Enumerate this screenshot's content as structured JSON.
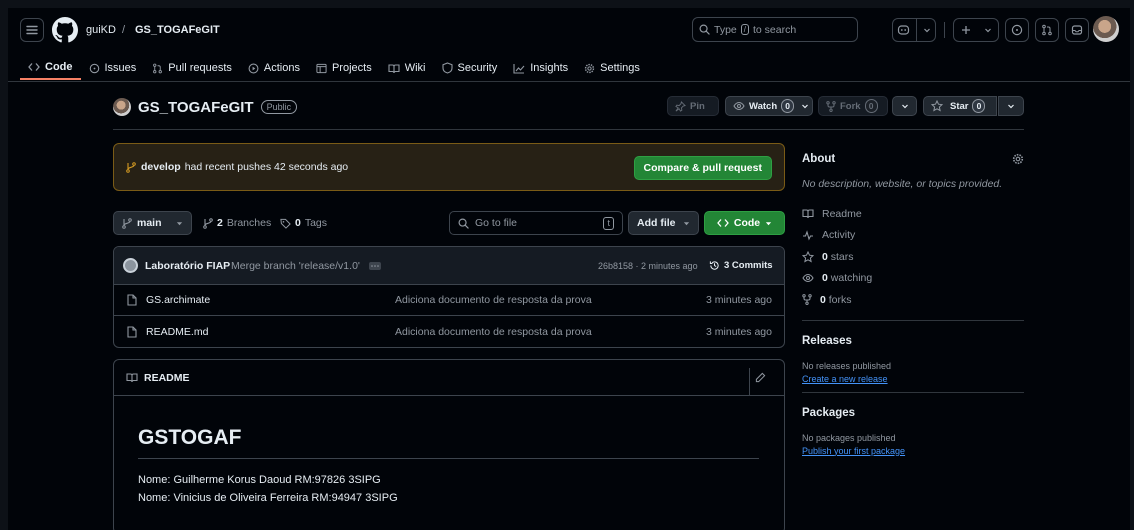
{
  "header": {
    "owner": "guiKD",
    "separator": "/",
    "repo": "GS_TOGAFeGIT",
    "search_placeholder": "Type / to search",
    "search_key": "/",
    "search_prefix": "Type",
    "search_suffix": "to search"
  },
  "tabs": [
    {
      "label": "Code",
      "icon": "code-icon",
      "active": true
    },
    {
      "label": "Issues",
      "icon": "issue-icon"
    },
    {
      "label": "Pull requests",
      "icon": "pull-request-icon"
    },
    {
      "label": "Actions",
      "icon": "play-icon"
    },
    {
      "label": "Projects",
      "icon": "table-icon"
    },
    {
      "label": "Wiki",
      "icon": "book-icon"
    },
    {
      "label": "Security",
      "icon": "shield-icon"
    },
    {
      "label": "Insights",
      "icon": "graph-icon"
    },
    {
      "label": "Settings",
      "icon": "gear-icon"
    }
  ],
  "repo_header": {
    "name": "GS_TOGAFeGIT",
    "visibility": "Public",
    "pin": "Pin",
    "watch": "Watch",
    "watch_count": "0",
    "fork": "Fork",
    "fork_count": "0",
    "star": "Star",
    "star_count": "0"
  },
  "push_banner": {
    "branch": "develop",
    "text": "had recent pushes 42 seconds ago",
    "button": "Compare & pull request"
  },
  "file_nav": {
    "branch": "main",
    "branches_count": "2",
    "branches_label": "Branches",
    "tags_count": "0",
    "tags_label": "Tags",
    "go_to_file": "Go to file",
    "go_to_file_key": "t",
    "add_file": "Add file",
    "code": "Code"
  },
  "latest_commit": {
    "author": "Laboratório FIAP",
    "message": "Merge branch 'release/v1.0'",
    "hash_time": "26b8158 · 2 minutes ago",
    "commits": "3 Commits"
  },
  "files": [
    {
      "name": "GS.archimate",
      "message": "Adiciona documento de resposta da prova",
      "time": "3 minutes ago"
    },
    {
      "name": "README.md",
      "message": "Adiciona documento de resposta da prova",
      "time": "3 minutes ago"
    }
  ],
  "readme": {
    "tab": "README",
    "title": "GSTOGAF",
    "lines": [
      "Nome: Guilherme Korus Daoud RM:97826 3SIPG",
      "Nome: Vinicius de Oliveira Ferreira RM:94947 3SIPG"
    ]
  },
  "sidebar": {
    "about_title": "About",
    "description": "No description, website, or topics provided.",
    "readme": "Readme",
    "activity": "Activity",
    "stars_count": "0",
    "stars_label": "stars",
    "watching_count": "0",
    "watching_label": "watching",
    "forks_count": "0",
    "forks_label": "forks",
    "releases_title": "Releases",
    "releases_text": "No releases published",
    "releases_link": "Create a new release",
    "packages_title": "Packages",
    "packages_text": "No packages published",
    "packages_link": "Publish your first package"
  },
  "colors": {
    "background": "#010409",
    "accent_green": "#238636",
    "tab_underline": "#f78166",
    "link": "#4493f8",
    "banner_bg": "#272115",
    "banner_border": "#7a5b16"
  }
}
